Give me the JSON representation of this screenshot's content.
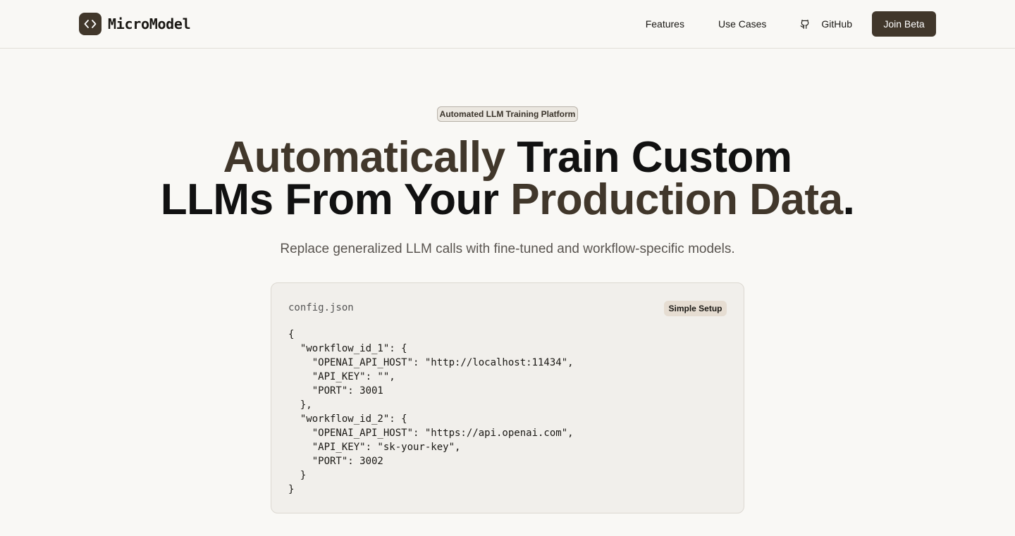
{
  "brand": {
    "name": "MicroModel",
    "logo_icon": "code-brackets-icon",
    "accent": "#41372b"
  },
  "nav": {
    "links": [
      "Features",
      "Use Cases"
    ],
    "github_label": "GitHub",
    "cta_label": "Join Beta"
  },
  "hero": {
    "badge": "Automated LLM Training Platform",
    "headline": {
      "part1": "Automatically",
      "part2": " Train Custom",
      "part3": "LLMs From Your ",
      "part4": "Production Data",
      "part5": "."
    },
    "subheading": "Replace generalized LLM calls with fine-tuned and workflow-specific models."
  },
  "code_card": {
    "filename": "config.json",
    "tag": "Simple Setup",
    "code": "{\n  \"workflow_id_1\": {\n    \"OPENAI_API_HOST\": \"http://localhost:11434\",\n    \"API_KEY\": \"\",\n    \"PORT\": 3001\n  },\n  \"workflow_id_2\": {\n    \"OPENAI_API_HOST\": \"https://api.openai.com\",\n    \"API_KEY\": \"sk-your-key\",\n    \"PORT\": 3002\n  }\n}"
  }
}
